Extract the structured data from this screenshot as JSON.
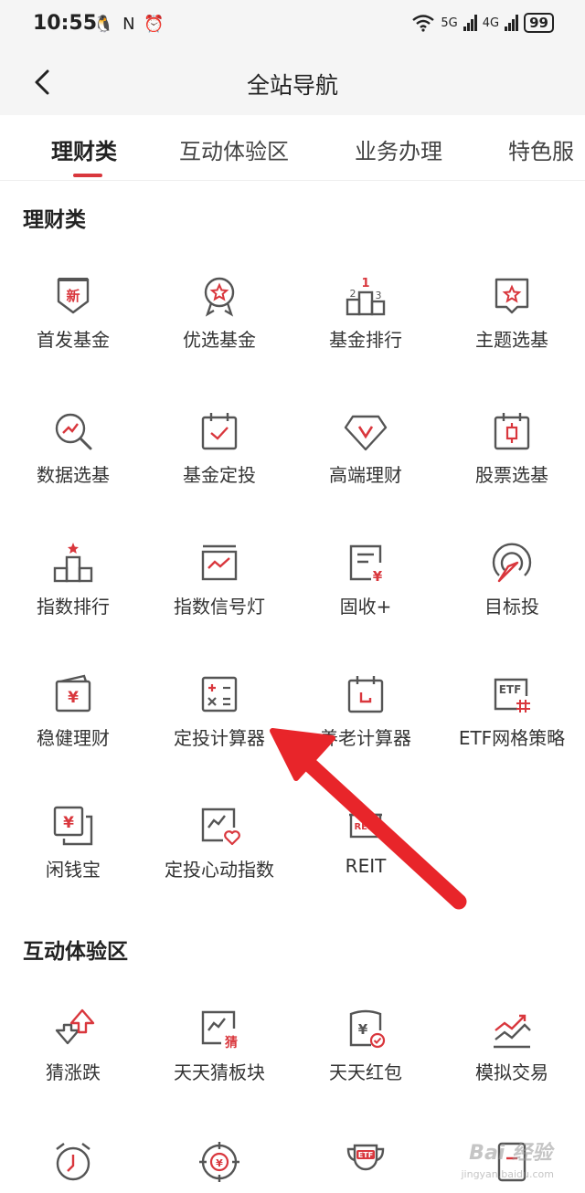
{
  "status_bar": {
    "time": "10:55",
    "icons": "🐧 N ⏰",
    "net1": "5G",
    "net2": "4G",
    "battery": "99"
  },
  "nav": {
    "title": "全站导航"
  },
  "tabs": [
    {
      "label": "理财类"
    },
    {
      "label": "互动体验区"
    },
    {
      "label": "业务办理"
    },
    {
      "label": "特色服"
    }
  ],
  "colors": {
    "accent": "#d9373d",
    "icon_gray": "#555555"
  },
  "sections": [
    {
      "title": "理财类",
      "items": [
        {
          "label": "首发基金",
          "icon": "new-badge-icon"
        },
        {
          "label": "优选基金",
          "icon": "medal-icon"
        },
        {
          "label": "基金排行",
          "icon": "podium-icon"
        },
        {
          "label": "主题选基",
          "icon": "theme-bookmark-icon"
        },
        {
          "label": "数据选基",
          "icon": "data-search-icon"
        },
        {
          "label": "基金定投",
          "icon": "calendar-check-icon"
        },
        {
          "label": "高端理财",
          "icon": "diamond-icon"
        },
        {
          "label": "股票选基",
          "icon": "stock-calendar-icon"
        },
        {
          "label": "指数排行",
          "icon": "index-rank-icon"
        },
        {
          "label": "指数信号灯",
          "icon": "signal-chart-icon"
        },
        {
          "label": "固收+",
          "icon": "fixed-income-icon"
        },
        {
          "label": "目标投",
          "icon": "target-icon"
        },
        {
          "label": "稳健理财",
          "icon": "wallet-icon"
        },
        {
          "label": "定投计算器",
          "icon": "calculator-icon"
        },
        {
          "label": "养老计算器",
          "icon": "pension-calendar-icon"
        },
        {
          "label": "ETF网格策略",
          "icon": "etf-grid-icon"
        },
        {
          "label": "闲钱宝",
          "icon": "spare-cash-icon"
        },
        {
          "label": "定投心动指数",
          "icon": "heart-chart-icon"
        },
        {
          "label": "REIT",
          "icon": "reit-icon"
        }
      ]
    },
    {
      "title": "互动体验区",
      "items": [
        {
          "label": "猜涨跌",
          "icon": "up-down-arrows-icon"
        },
        {
          "label": "天天猜板块",
          "icon": "guess-sector-icon"
        },
        {
          "label": "天天红包",
          "icon": "red-packet-icon"
        },
        {
          "label": "模拟交易",
          "icon": "simulated-trade-icon"
        },
        {
          "label": "",
          "icon": "alarm-clock-icon"
        },
        {
          "label": "",
          "icon": "target-coin-icon"
        },
        {
          "label": "",
          "icon": "etf-trophy-icon"
        },
        {
          "label": "",
          "icon": "device-icon"
        }
      ]
    }
  ],
  "watermark": {
    "text": "Bai 经验",
    "sub": "jingyan.baidu.com"
  }
}
